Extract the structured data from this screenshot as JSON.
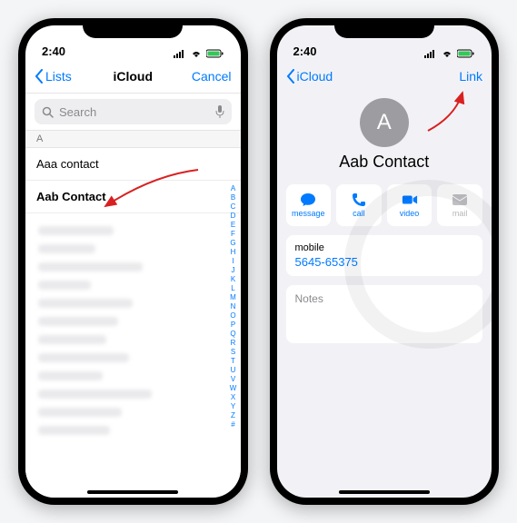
{
  "left": {
    "status_time": "2:40",
    "nav_back": "Lists",
    "nav_title": "iCloud",
    "nav_cancel": "Cancel",
    "search_placeholder": "Search",
    "section_header": "A",
    "row1": "Aaa contact",
    "row2": "Aab Contact",
    "index": [
      "A",
      "B",
      "C",
      "D",
      "E",
      "F",
      "G",
      "H",
      "I",
      "J",
      "K",
      "L",
      "M",
      "N",
      "O",
      "P",
      "Q",
      "R",
      "S",
      "T",
      "U",
      "V",
      "W",
      "X",
      "Y",
      "Z",
      "#"
    ]
  },
  "right": {
    "status_time": "2:40",
    "nav_back": "iCloud",
    "nav_link": "Link",
    "avatar_initial": "A",
    "contact_name": "Aab Contact",
    "actions": {
      "message": "message",
      "call": "call",
      "video": "video",
      "mail": "mail"
    },
    "mobile_label": "mobile",
    "mobile_value": "5645-65375",
    "notes_label": "Notes"
  }
}
